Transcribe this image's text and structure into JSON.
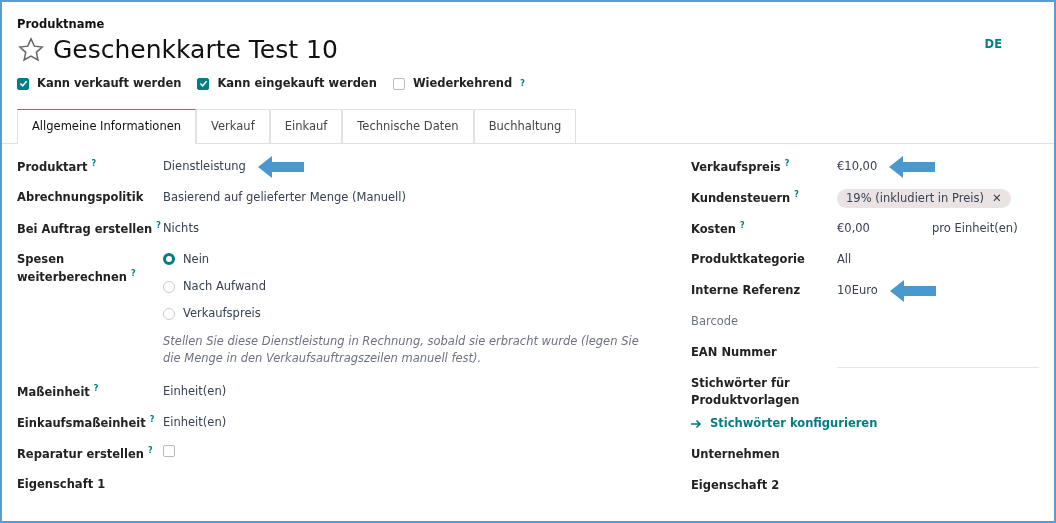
{
  "header": {
    "label": "Produktname",
    "title": "Geschenkkarte Test 10",
    "favorite": false,
    "language": "DE"
  },
  "options": [
    {
      "label": "Kann verkauft werden",
      "checked": true
    },
    {
      "label": "Kann eingekauft werden",
      "checked": true
    },
    {
      "label": "Wiederkehrend",
      "checked": false,
      "help": "?"
    }
  ],
  "tabs": [
    {
      "label": "Allgemeine Informationen",
      "selected": true
    },
    {
      "label": "Verkauf",
      "selected": false
    },
    {
      "label": "Einkauf",
      "selected": false
    },
    {
      "label": "Technische Daten",
      "selected": false
    },
    {
      "label": "Buchhaltung",
      "selected": false
    }
  ],
  "left_fields": [
    {
      "kind": "text",
      "label": "Produktart",
      "help": "?",
      "value": "Dienstleistung",
      "arrow": true
    },
    {
      "kind": "text",
      "label": "Abrechnungspolitik",
      "value": "Basierend auf gelieferter Menge (Manuell)"
    },
    {
      "kind": "text",
      "label": "Bei Auftrag erstellen",
      "help": "?",
      "value": "Nichts"
    },
    {
      "kind": "radio",
      "label": "Spesen weiterberechnen",
      "help": "?",
      "options": [
        {
          "label": "Nein",
          "selected": true
        },
        {
          "label": "Nach Aufwand",
          "selected": false
        },
        {
          "label": "Verkaufspreis",
          "selected": false
        }
      ]
    },
    {
      "kind": "note",
      "value": "Stellen Sie diese Dienstleistung in Rechnung, sobald sie erbracht wurde (legen Sie die Menge in den Verkaufsauftragszeilen manuell fest)."
    },
    {
      "kind": "text",
      "label": "Maßeinheit",
      "help": "?",
      "value": "Einheit(en)"
    },
    {
      "kind": "text",
      "label": "Einkaufsmaßeinheit",
      "help": "?",
      "value": "Einheit(en)"
    },
    {
      "kind": "checkbox",
      "label": "Reparatur erstellen",
      "help": "?",
      "checked": false
    },
    {
      "kind": "text",
      "label": "Eigenschaft 1"
    }
  ],
  "right_fields": [
    {
      "kind": "text",
      "label": "Verkaufspreis",
      "help": "?",
      "value": "€10,00",
      "arrow": true
    },
    {
      "kind": "tag",
      "label": "Kundensteuern",
      "help": "?",
      "value": "19% (inkludiert in Preis)",
      "remove": "✕"
    },
    {
      "kind": "cost",
      "label": "Kosten",
      "help": "?",
      "value": "€0,00",
      "unit": "pro Einheit(en)"
    },
    {
      "kind": "text",
      "label": "Produktkategorie",
      "value": "All"
    },
    {
      "kind": "text",
      "label": "Interne Referenz",
      "value": "10Euro",
      "arrow": true
    },
    {
      "kind": "muted",
      "label": "Barcode"
    },
    {
      "kind": "input",
      "label": "EAN Nummer"
    },
    {
      "kind": "text",
      "label": "Stichwörter für Produktvorlagen"
    },
    {
      "kind": "link",
      "value": "Stichwörter konfigurieren"
    },
    {
      "kind": "text",
      "label": "Unternehmen"
    },
    {
      "kind": "text",
      "label": "Eigenschaft 2"
    }
  ]
}
